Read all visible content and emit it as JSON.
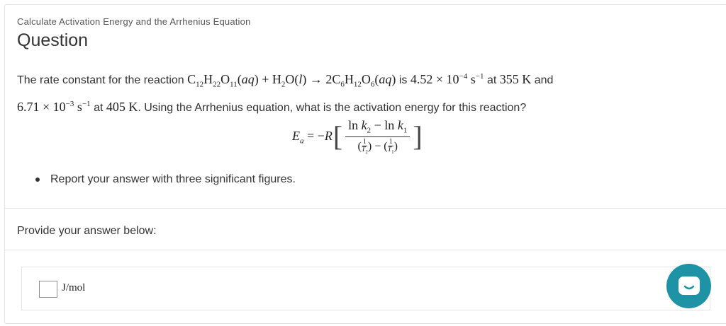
{
  "header": {
    "breadcrumb": "Calculate Activation Energy and the Arrhenius Equation",
    "title": "Question"
  },
  "question": {
    "text_1": "The rate constant for the reaction",
    "text_2": "is",
    "text_3": "at",
    "text_4": "and",
    "text_5": "at",
    "text_6": ". Using the Arrhenius equation, what is the activation energy for this reaction?",
    "k1_value": "4.52 × 10",
    "k1_exp": "−4",
    "k1_unit": "s",
    "k1_unit_exp": "−1",
    "T1": "355 K",
    "k2_value": "6.71 × 10",
    "k2_exp": "−3",
    "k2_unit": "s",
    "k2_unit_exp": "−1",
    "T2": "405 K"
  },
  "bullets": [
    "Report your answer with three significant figures."
  ],
  "answer": {
    "prompt": "Provide your answer below:",
    "value": "",
    "unit": "J/mol"
  },
  "chat_icon": "chat-bubble-icon"
}
